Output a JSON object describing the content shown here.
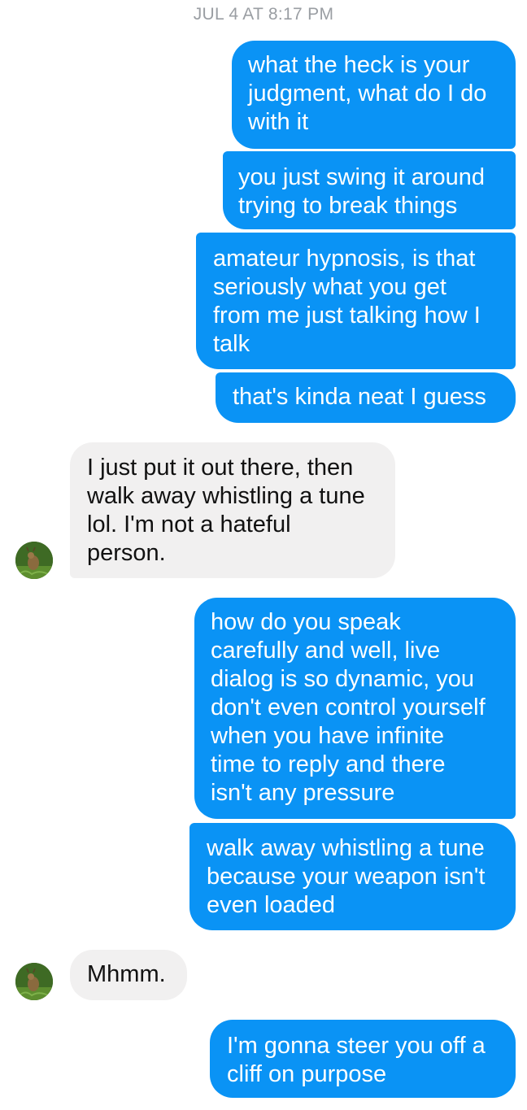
{
  "conversation": {
    "timestamp": "JUL 4 AT 8:17 PM",
    "messages": [
      {
        "sender": "me",
        "text": "what the heck is your\njudgment, what do I do\nwith it"
      },
      {
        "sender": "me",
        "text": "you just swing it around\ntrying to break things"
      },
      {
        "sender": "me",
        "text": "amateur hypnosis, is that\nseriously what you get\nfrom me just talking how I\ntalk"
      },
      {
        "sender": "me",
        "text": "that's kinda neat I guess"
      },
      {
        "sender": "them",
        "text": "I just put it out there, then\nwalk away whistling a tune\nlol. I'm not a hateful\nperson."
      },
      {
        "sender": "me",
        "text": "how do you speak\ncarefully and well, live\ndialog is so dynamic, you\ndon't even control yourself\nwhen you have infinite\ntime to reply and there\nisn't any pressure"
      },
      {
        "sender": "me",
        "text": "walk away whistling a tune\nbecause your weapon isn't\neven loaded"
      },
      {
        "sender": "them",
        "text": "Mhmm."
      },
      {
        "sender": "me",
        "text": "I'm gonna steer you off a\ncliff on purpose"
      }
    ]
  },
  "colors": {
    "outgoing_bubble": "#0a93f5",
    "incoming_bubble": "#f1f0f0",
    "timestamp_text": "#9a9ea3"
  },
  "icons": {
    "contact_avatar": "deer-photo-avatar-icon"
  }
}
